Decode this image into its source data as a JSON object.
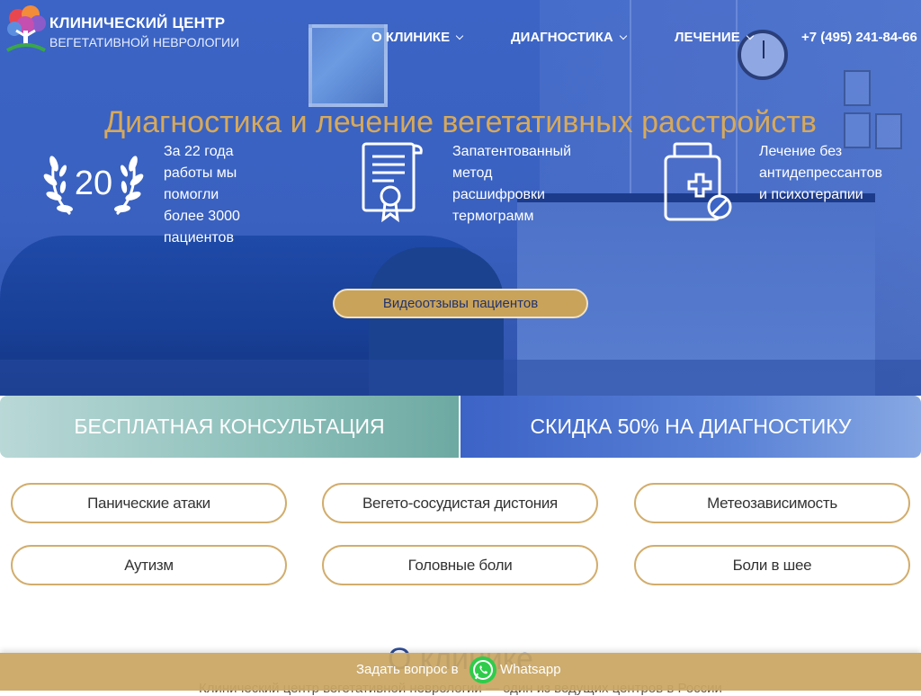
{
  "header": {
    "brand_title": "КЛИНИЧЕСКИЙ ЦЕНТР",
    "brand_subtitle": "ВЕГЕТАТИВНОЙ НЕВРОЛОГИИ",
    "nav": [
      {
        "label": "О КЛИНИКЕ",
        "icon": "chevron-down-icon"
      },
      {
        "label": "ДИАГНОСТИКА",
        "icon": "chevron-down-icon"
      },
      {
        "label": "ЛЕЧЕНИЕ",
        "icon": "chevron-down-icon"
      }
    ],
    "phone": "+7 (495) 241-84-66"
  },
  "hero": {
    "title": "Диагностика и лечение вегетативных расстройств",
    "features": [
      {
        "icon": "laurel-wreath-icon",
        "icon_text": "20",
        "lines": [
          "За 22 года",
          "работы мы",
          "помогли",
          "более 3000",
          "пациентов"
        ]
      },
      {
        "icon": "certificate-icon",
        "lines": [
          "Запатентованный",
          "метод",
          "расшифровки",
          "термограмм"
        ]
      },
      {
        "icon": "medicine-bottle-icon",
        "lines": [
          "Лечение без",
          "антидепрессантов",
          "и психотерапии"
        ]
      }
    ],
    "video_button": "Видеоотзывы пациентов"
  },
  "banners": {
    "left": "БЕСПЛАТНАЯ КОНСУЛЬТАЦИЯ",
    "right": "СКИДКА 50% НА ДИАГНОСТИКУ"
  },
  "topics": [
    "Панические атаки",
    "Вегето-сосудистая дистония",
    "Метеозависимость",
    "Аутизм",
    "Головные боли",
    "Боли в шее"
  ],
  "about": {
    "title": "О клинике",
    "text": "Клинический центр вегетативной неврологии — один из ведущих центров в России"
  },
  "bottom_bar": {
    "text_before": "Задать вопрос в",
    "icon": "whatsapp-icon",
    "text_after": "Whatsapp"
  },
  "colors": {
    "hero_blue": "#3b64c6",
    "gold": "#c9a35a",
    "teal": "#6da9a2",
    "pill_border": "#d2ad6d",
    "whatsapp_green": "#2ecc4a"
  }
}
